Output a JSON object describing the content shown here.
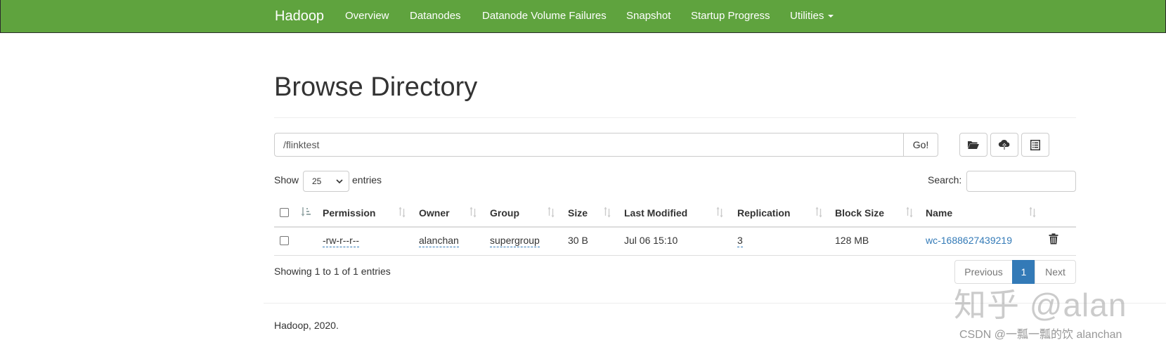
{
  "navbar": {
    "brand": "Hadoop",
    "items": [
      "Overview",
      "Datanodes",
      "Datanode Volume Failures",
      "Snapshot",
      "Startup Progress",
      "Utilities"
    ],
    "color": "#5fa33e"
  },
  "page": {
    "title": "Browse Directory"
  },
  "pathbar": {
    "value": "/flinktest",
    "go_label": "Go!",
    "tool_icons": [
      "folder-open-icon",
      "cloud-upload-icon",
      "list-alt-icon"
    ]
  },
  "table_controls": {
    "show_label": "Show",
    "page_size": "25",
    "entries_label": "entries",
    "search_label": "Search:",
    "search_value": ""
  },
  "table": {
    "columns": [
      "Permission",
      "Owner",
      "Group",
      "Size",
      "Last Modified",
      "Replication",
      "Block Size",
      "Name"
    ],
    "rows": [
      {
        "permission": "-rw-r--r--",
        "owner": "alanchan",
        "group": "supergroup",
        "size": "30 B",
        "last_modified": "Jul 06 15:10",
        "replication": "3",
        "block_size": "128 MB",
        "name": "wc-1688627439219"
      }
    ],
    "link_color": "#337ab7"
  },
  "pagination": {
    "info": "Showing 1 to 1 of 1 entries",
    "previous_label": "Previous",
    "current_page": "1",
    "next_label": "Next"
  },
  "footer": {
    "copyright": "Hadoop, 2020."
  },
  "watermark": {
    "big": "知乎 @alan",
    "small": "CSDN @一瓢一瓢的饮 alanchan"
  }
}
